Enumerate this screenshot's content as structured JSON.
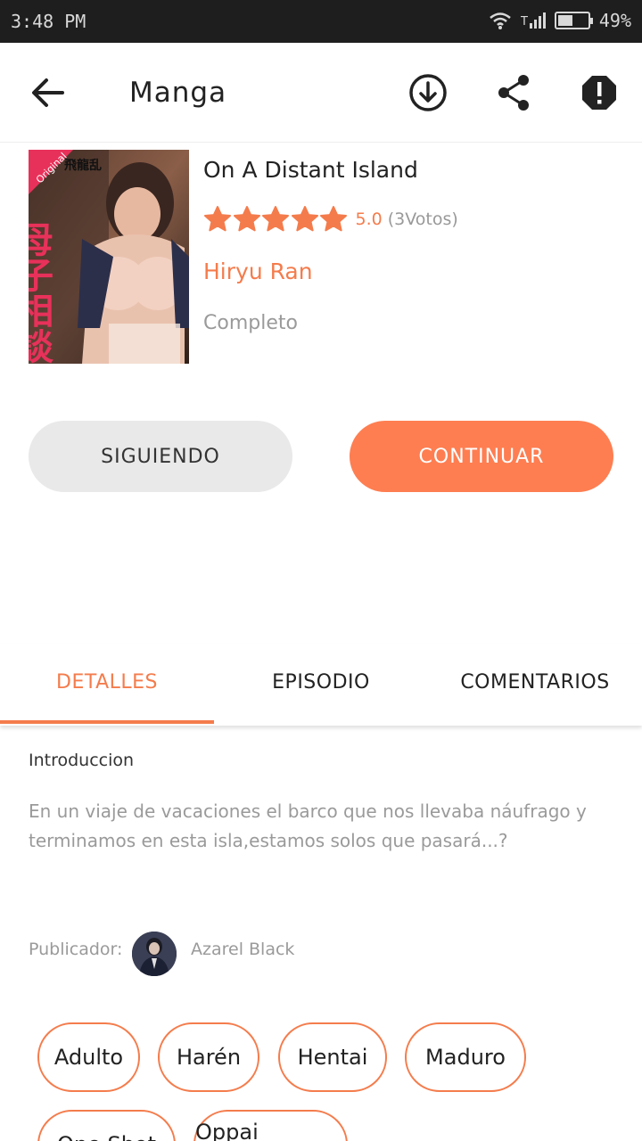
{
  "status_bar": {
    "time": "3:48 PM",
    "battery": "49%",
    "battery_level": 0.49
  },
  "appbar": {
    "title": "Manga"
  },
  "manga": {
    "title": "On A Distant Island",
    "rating": "5.0",
    "votes": "(3Votos)",
    "stars": 5,
    "author": "Hiryu Ran",
    "status": "Completo",
    "cover_text": {
      "badge": "Original",
      "author_jp": "飛龍乱",
      "title_jp": "母子相談"
    }
  },
  "buttons": {
    "follow": "SIGUIENDO",
    "continue": "CONTINUAR"
  },
  "tabs": [
    {
      "label": "DETALLES",
      "active": true
    },
    {
      "label": "EPISODIO",
      "active": false
    },
    {
      "label": "COMENTARIOS",
      "active": false
    }
  ],
  "details": {
    "intro_label": "Introduccion",
    "intro_text": "En un viaje de vacaciones el barco que nos llevaba náufrago y terminamos en esta isla,estamos solos que pasará...?",
    "publisher_label": "Publicador:",
    "publisher_name": "Azarel Black"
  },
  "tags": [
    "Adulto",
    "Harén",
    "Hentai",
    "Maduro",
    "One Shot",
    "Oppai Hamster"
  ],
  "colors": {
    "accent": "#f47c4c",
    "button_accent": "#fe7e51",
    "button_grey": "#e9e9e9",
    "status_bar": "#1e1e1e"
  },
  "icons": [
    "back-arrow-icon",
    "download-icon",
    "share-icon",
    "report-icon",
    "star-icon",
    "wifi-icon",
    "signal-icon",
    "battery-icon"
  ]
}
